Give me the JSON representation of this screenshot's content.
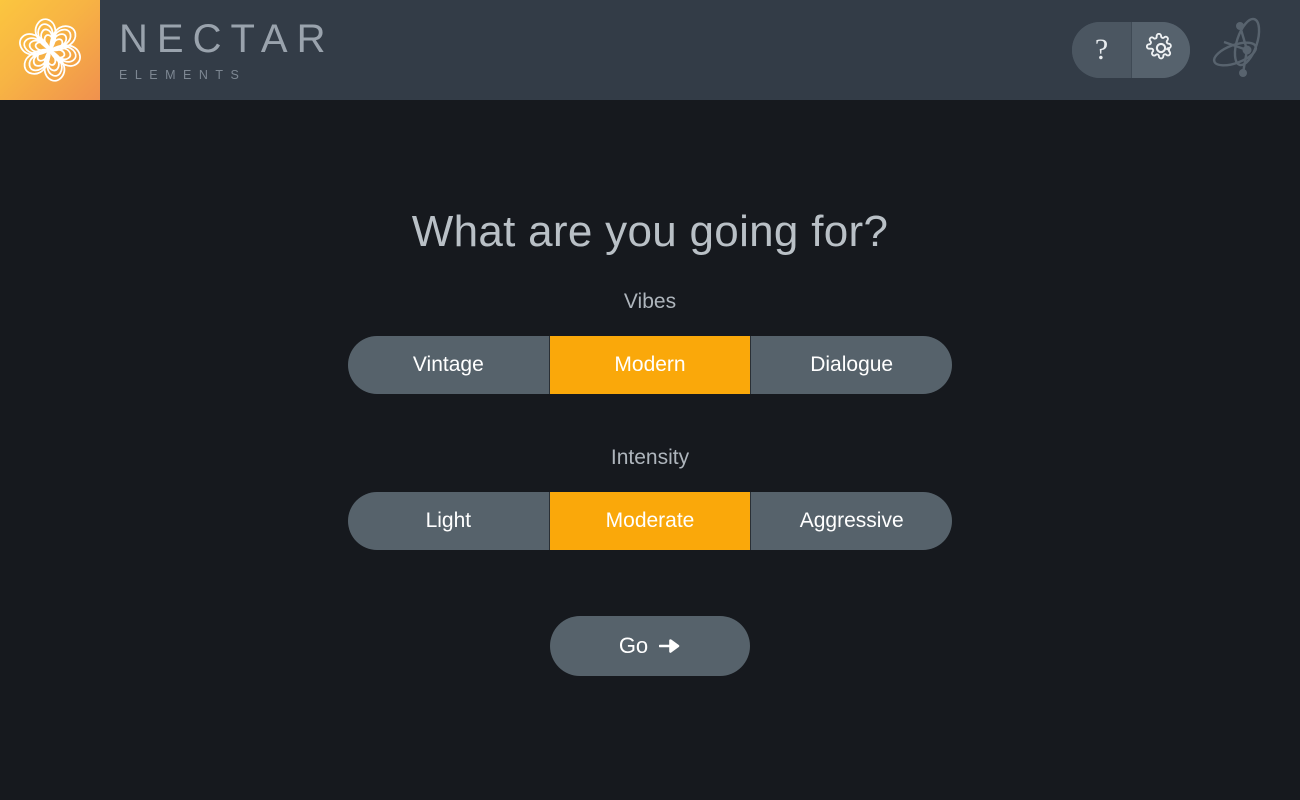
{
  "header": {
    "brand_name": "NECTAR",
    "brand_subtitle": "ELEMENTS",
    "logo_icon": "nectar-pinwheel-logo",
    "help_icon": "question-mark-icon",
    "help_label": "?",
    "gear_icon": "gear-icon",
    "decoration_icon": "orbit-nodes-decoration-icon",
    "colors": {
      "bar": "#333c47",
      "logo_gradient_start": "#fbc63f",
      "logo_gradient_end": "#f0914e",
      "pill": "#4e5a65"
    }
  },
  "main": {
    "title": "What are you going for?",
    "groups": [
      {
        "label": "Vibes",
        "options": [
          {
            "label": "Vintage",
            "selected": false
          },
          {
            "label": "Modern",
            "selected": true
          },
          {
            "label": "Dialogue",
            "selected": false
          }
        ]
      },
      {
        "label": "Intensity",
        "options": [
          {
            "label": "Light",
            "selected": false
          },
          {
            "label": "Moderate",
            "selected": true
          },
          {
            "label": "Aggressive",
            "selected": false
          }
        ]
      }
    ],
    "go_button": {
      "label": "Go",
      "arrow_icon": "arrow-right-icon"
    },
    "colors": {
      "background": "#16191e",
      "accent": "#faa80a",
      "segment": "#56626b",
      "title_text": "#b9c0c6"
    }
  }
}
